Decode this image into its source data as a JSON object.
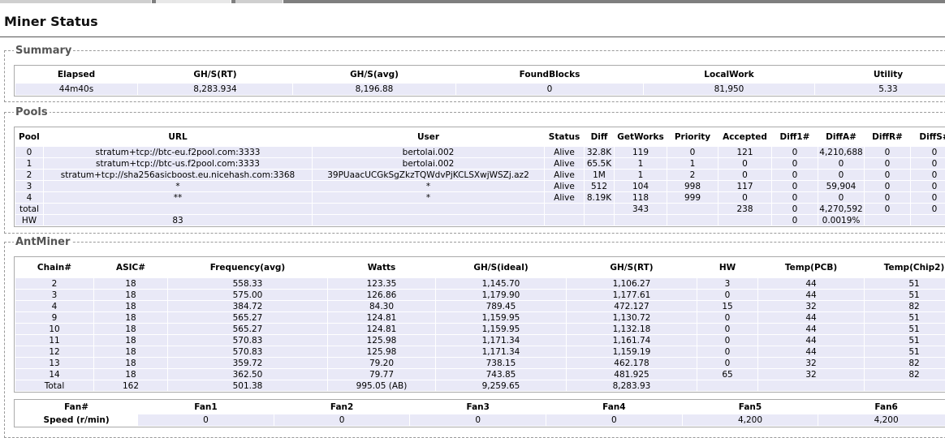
{
  "page": {
    "title": "Miner Status"
  },
  "summary": {
    "legend": "Summary",
    "headers": [
      "Elapsed",
      "GH/S(RT)",
      "GH/S(avg)",
      "FoundBlocks",
      "LocalWork",
      "Utility"
    ],
    "row": [
      "44m40s",
      "8,283.934",
      "8,196.88",
      "0",
      "81,950",
      "5.33"
    ]
  },
  "pools": {
    "legend": "Pools",
    "headers": [
      "Pool",
      "URL",
      "User",
      "Status",
      "Diff",
      "GetWorks",
      "Priority",
      "Accepted",
      "Diff1#",
      "DiffA#",
      "DiffR#",
      "DiffS#"
    ],
    "rows": [
      [
        "0",
        "stratum+tcp://btc-eu.f2pool.com:3333",
        "bertolai.002",
        "Alive",
        "32.8K",
        "119",
        "0",
        "121",
        "0",
        "4,210,688",
        "0",
        "0"
      ],
      [
        "1",
        "stratum+tcp://btc-us.f2pool.com:3333",
        "bertolai.002",
        "Alive",
        "65.5K",
        "1",
        "1",
        "0",
        "0",
        "0",
        "0",
        "0"
      ],
      [
        "2",
        "stratum+tcp://sha256asicboost.eu.nicehash.com:3368",
        "39PUaacUCGkSgZkzTQWdvPjKCLSXwjWSZj.az2",
        "Alive",
        "1M",
        "1",
        "2",
        "0",
        "0",
        "0",
        "0",
        "0"
      ],
      [
        "3",
        "*",
        "*",
        "Alive",
        "512",
        "104",
        "998",
        "117",
        "0",
        "59,904",
        "0",
        "0"
      ],
      [
        "4",
        "**",
        "*",
        "Alive",
        "8.19K",
        "118",
        "999",
        "0",
        "0",
        "0",
        "0",
        "0"
      ],
      [
        "total",
        "",
        "",
        "",
        "",
        "343",
        "",
        "238",
        "0",
        "4,270,592",
        "0",
        "0"
      ],
      [
        "HW",
        "83",
        "",
        "",
        "",
        "",
        "",
        "",
        "0",
        "0.0019%",
        "",
        ""
      ]
    ]
  },
  "antminer": {
    "legend": "AntMiner",
    "headers": [
      "Chain#",
      "ASIC#",
      "Frequency(avg)",
      "Watts",
      "GH/S(ideal)",
      "GH/S(RT)",
      "HW",
      "Temp(PCB)",
      "Temp(Chip2)"
    ],
    "rows": [
      [
        "2",
        "18",
        "558.33",
        "123.35",
        "1,145.70",
        "1,106.27",
        "3",
        "44",
        "51"
      ],
      [
        "3",
        "18",
        "575.00",
        "126.86",
        "1,179.90",
        "1,177.61",
        "0",
        "44",
        "51"
      ],
      [
        "4",
        "18",
        "384.72",
        "84.30",
        "789.45",
        "472.127",
        "15",
        "32",
        "82"
      ],
      [
        "9",
        "18",
        "565.27",
        "124.81",
        "1,159.95",
        "1,130.72",
        "0",
        "44",
        "51"
      ],
      [
        "10",
        "18",
        "565.27",
        "124.81",
        "1,159.95",
        "1,132.18",
        "0",
        "44",
        "51"
      ],
      [
        "11",
        "18",
        "570.83",
        "125.98",
        "1,171.34",
        "1,161.74",
        "0",
        "44",
        "51"
      ],
      [
        "12",
        "18",
        "570.83",
        "125.98",
        "1,171.34",
        "1,159.19",
        "0",
        "44",
        "51"
      ],
      [
        "13",
        "18",
        "359.72",
        "79.20",
        "738.15",
        "462.178",
        "0",
        "32",
        "82"
      ],
      [
        "14",
        "18",
        "362.50",
        "79.77",
        "743.85",
        "481.925",
        "65",
        "32",
        "82"
      ],
      [
        "Total",
        "162",
        "501.38",
        "995.05 (AB)",
        "9,259.65",
        "8,283.93",
        "",
        "",
        ""
      ]
    ]
  },
  "fans": {
    "headers": [
      "Fan#",
      "Fan1",
      "Fan2",
      "Fan3",
      "Fan4",
      "Fan5",
      "Fan6"
    ],
    "row": [
      "Speed (r/min)",
      "0",
      "0",
      "0",
      "0",
      "4,200",
      "4,200"
    ]
  }
}
